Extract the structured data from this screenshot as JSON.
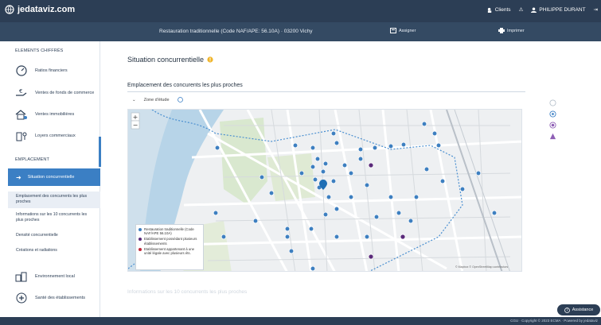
{
  "header": {
    "brand": "jedataviz.com",
    "clients_label": "Clients",
    "user_label": "PHILIPPE DURANT"
  },
  "subheader": {
    "project": "Restauration traditionnelle (Code NAF/APE: 56.10A) · 03200 Vichy",
    "btn_assigner": "Assigner",
    "btn_imprimer": "Imprimer"
  },
  "sidebar": {
    "section_chiffres": "ELEMENTS CHIFFRÉS",
    "items_top": [
      {
        "label": "Ratios financiers"
      },
      {
        "label": "Ventes de fonds de commerce"
      },
      {
        "label": "Ventes immobilières"
      },
      {
        "label": "Loyers commerciaux"
      }
    ],
    "section_emplacement": "EMPLACEMENT",
    "active_label": "Situation concurrentielle",
    "sub_items": [
      {
        "label": "Emplacement des concurrents les plus proches"
      },
      {
        "label": "Informations sur les 10 concurrents les plus proches"
      },
      {
        "label": "Densité concurrentielle"
      },
      {
        "label": "Créations et radiations"
      }
    ],
    "items_bottom": [
      {
        "label": "Environnement local"
      },
      {
        "label": "Santé des établissements"
      }
    ]
  },
  "main": {
    "title": "Situation concurrentielle",
    "section_title": "Emplacement des concurents les plus proches",
    "zone_label": "Zone d'étude",
    "next_section": "Informations sur les 10 concurrents les plus proches"
  },
  "map": {
    "zoom_in": "+",
    "zoom_out": "−",
    "attribution": "© Mapbox © OpenStreetMap contributors",
    "legend": [
      {
        "label": "Restauration traditionnelle (Code NAF/APE 56.10A)",
        "color": "#3d7fc0"
      },
      {
        "label": "Etablissement possédant plusieurs établissements",
        "color": "#5a2a7a"
      },
      {
        "label": "Etablissement appartenant à une unité légale avec plusieurs éts.",
        "color": "#c0283a"
      }
    ]
  },
  "assistance": {
    "label": "Assistance"
  },
  "footer": {
    "text": "CGU · Copyright © 2023 ECMA · Powered by jedataviz"
  },
  "colors": {
    "nav": "#2c3e55",
    "accent": "#3b7fc4",
    "marker": "#3d7fc0",
    "marker_purple": "#5a2a7a",
    "warning": "#f0b429"
  }
}
